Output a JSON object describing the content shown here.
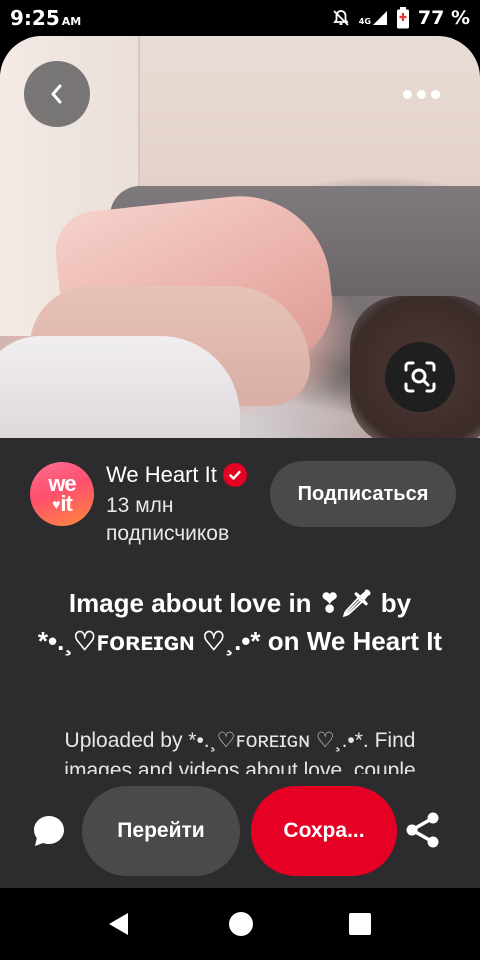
{
  "status_bar": {
    "time": "9:25",
    "ampm": "AM",
    "network": "4G",
    "battery": "77 %"
  },
  "top_controls": {
    "back_icon": "chevron-left-icon",
    "more_icon": "more-horizontal-icon",
    "lens_icon": "visual-search-icon"
  },
  "creator": {
    "avatar_text_top": "we",
    "avatar_text_bottom": "it",
    "name": "We Heart It",
    "followers": "13 млн подписчиков",
    "follow_label": "Подписаться"
  },
  "pin": {
    "title": "Image about love in ❣🗡 by *•.¸♡ꜰᴏʀᴇɪɢɴ ♡¸.•* on We Heart It",
    "description": "Uploaded by *•.¸♡ꜰᴏʀᴇɪɢɴ ♡¸.•*. Find images and videos about love, couple"
  },
  "actions": {
    "comment_icon": "comment-icon",
    "visit_label": "Перейти",
    "save_label": "Сохра...",
    "share_icon": "share-icon"
  },
  "colors": {
    "accent": "#e60023",
    "sheet_bg": "#2c2b2d",
    "button_bg": "#4a494b"
  }
}
